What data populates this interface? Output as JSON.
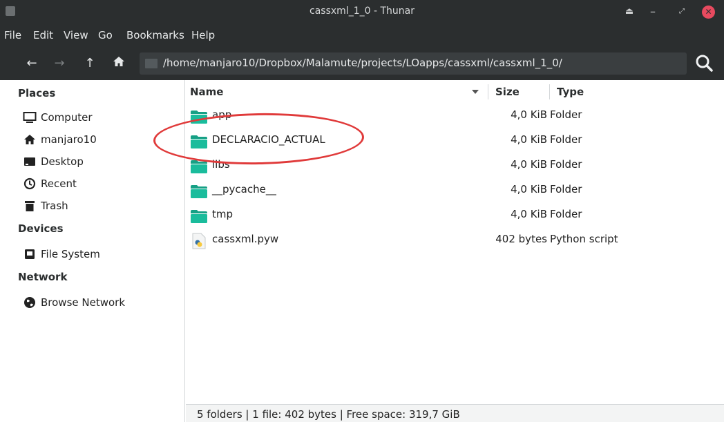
{
  "window": {
    "title": "cassxml_1_0 - Thunar"
  },
  "menu": [
    "File",
    "Edit",
    "View",
    "Go",
    "Bookmarks",
    "Help"
  ],
  "location": {
    "path": "/home/manjaro10/Dropbox/Malamute/projects/LOapps/cassxml/cassxml_1_0/"
  },
  "sidebar": {
    "places_heading": "Places",
    "places": [
      {
        "label": "Computer",
        "icon": "computer-icon"
      },
      {
        "label": "manjaro10",
        "icon": "home-icon"
      },
      {
        "label": "Desktop",
        "icon": "desktop-icon"
      },
      {
        "label": "Recent",
        "icon": "recent-icon"
      },
      {
        "label": "Trash",
        "icon": "trash-icon"
      }
    ],
    "devices_heading": "Devices",
    "devices": [
      {
        "label": "File System",
        "icon": "drive-icon"
      }
    ],
    "network_heading": "Network",
    "network": [
      {
        "label": "Browse Network",
        "icon": "globe-icon"
      }
    ]
  },
  "columns": {
    "name": "Name",
    "size": "Size",
    "type": "Type"
  },
  "files": [
    {
      "name": "app",
      "size": "4,0 KiB",
      "type": "Folder",
      "kind": "folder"
    },
    {
      "name": "DECLARACIO_ACTUAL",
      "size": "4,0 KiB",
      "type": "Folder",
      "kind": "folder"
    },
    {
      "name": "libs",
      "size": "4,0 KiB",
      "type": "Folder",
      "kind": "folder"
    },
    {
      "name": "__pycache__",
      "size": "4,0 KiB",
      "type": "Folder",
      "kind": "folder"
    },
    {
      "name": "tmp",
      "size": "4,0 KiB",
      "type": "Folder",
      "kind": "folder"
    },
    {
      "name": "cassxml.pyw",
      "size": "402 bytes",
      "type": "Python script",
      "kind": "python"
    }
  ],
  "status": {
    "text": "5 folders  |  1 file: 402 bytes  |  Free space: 319,7 GiB"
  },
  "colors": {
    "titlebar": "#2b2e2f",
    "folder": "#16a085",
    "folder_tab": "#1abc9c",
    "highlight": "#e03a3a"
  }
}
